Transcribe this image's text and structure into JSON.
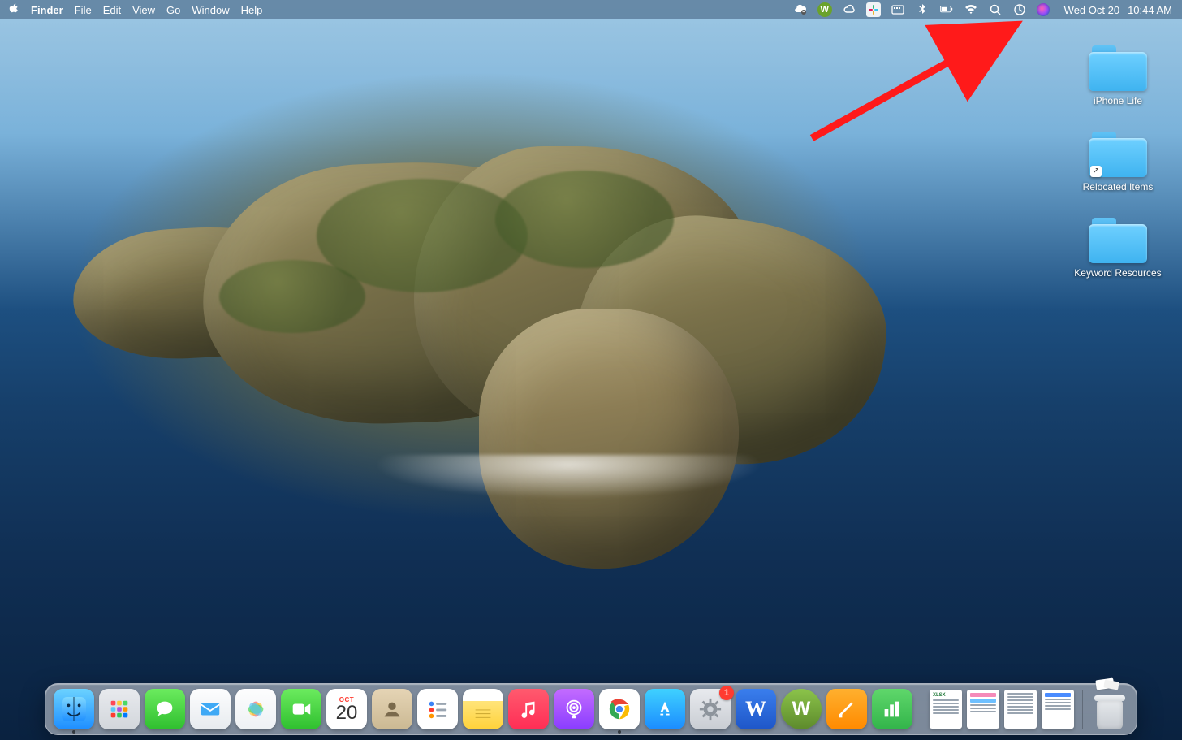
{
  "menubar": {
    "app_name": "Finder",
    "menus": [
      "File",
      "Edit",
      "View",
      "Go",
      "Window",
      "Help"
    ],
    "clock_date": "Wed Oct 20",
    "clock_time": "10:44 AM"
  },
  "status_icons": [
    {
      "name": "cloud-sync-icon"
    },
    {
      "name": "webroot-icon",
      "letter": "W",
      "color": "#6aa22c"
    },
    {
      "name": "creative-cloud-icon"
    },
    {
      "name": "slack-icon"
    },
    {
      "name": "input-menu-icon"
    },
    {
      "name": "bluetooth-icon"
    },
    {
      "name": "battery-icon"
    },
    {
      "name": "wifi-icon"
    },
    {
      "name": "spotlight-icon"
    },
    {
      "name": "time-machine-icon"
    },
    {
      "name": "siri-icon"
    }
  ],
  "desktop_items": [
    {
      "label": "iPhone Life",
      "type": "folder",
      "shortcut": false
    },
    {
      "label": "Relocated Items",
      "type": "folder",
      "shortcut": true
    },
    {
      "label": "Keyword Resources",
      "type": "folder",
      "shortcut": false
    }
  ],
  "dock": {
    "apps": [
      {
        "name": "finder",
        "bg": "linear-gradient(#6bd2ff,#1e8eff)",
        "running": true
      },
      {
        "name": "launchpad",
        "bg": "linear-gradient(#e8eaee,#d2d6db)"
      },
      {
        "name": "messages",
        "bg": "linear-gradient(#6beb5e,#2fbf2f)"
      },
      {
        "name": "mail",
        "bg": "linear-gradient(#fdfdfe,#e7ebef)"
      },
      {
        "name": "photos",
        "bg": "linear-gradient(#fdfdfe,#eef1f4)"
      },
      {
        "name": "facetime",
        "bg": "linear-gradient(#6beb5e,#2fbf2f)"
      },
      {
        "name": "calendar",
        "bg": "#ffffff",
        "cal_month": "OCT",
        "cal_day": "20"
      },
      {
        "name": "contacts",
        "bg": "linear-gradient(#e5d4b5,#cbb993)"
      },
      {
        "name": "reminders",
        "bg": "#ffffff"
      },
      {
        "name": "notes",
        "bg": "linear-gradient(#fff6d8,#ffe47a)"
      },
      {
        "name": "music",
        "bg": "linear-gradient(#ff5a6e,#ff2d55)"
      },
      {
        "name": "podcasts",
        "bg": "linear-gradient(#c36bff,#8a3dff)"
      },
      {
        "name": "chrome",
        "bg": "#ffffff",
        "running": true
      },
      {
        "name": "app-store",
        "bg": "linear-gradient(#3fd1ff,#1b8cff)"
      },
      {
        "name": "system-preferences",
        "bg": "linear-gradient(#e8eaee,#c9cdd3)",
        "badge": "1"
      },
      {
        "name": "word",
        "bg": "linear-gradient(#3a7eed,#1e56c8)"
      },
      {
        "name": "webroot",
        "bg": "linear-gradient(#8bc34a,#5d8a2c)"
      },
      {
        "name": "pages",
        "bg": "linear-gradient(#ffb02e,#ff8a00)"
      },
      {
        "name": "numbers",
        "bg": "linear-gradient(#5fd76b,#32b44a)"
      }
    ],
    "recents": [
      {
        "name": "document-1",
        "type": "spreadsheet"
      },
      {
        "name": "document-2",
        "type": "image-doc"
      },
      {
        "name": "document-3",
        "type": "text-doc"
      },
      {
        "name": "document-4",
        "type": "text-doc"
      }
    ]
  }
}
